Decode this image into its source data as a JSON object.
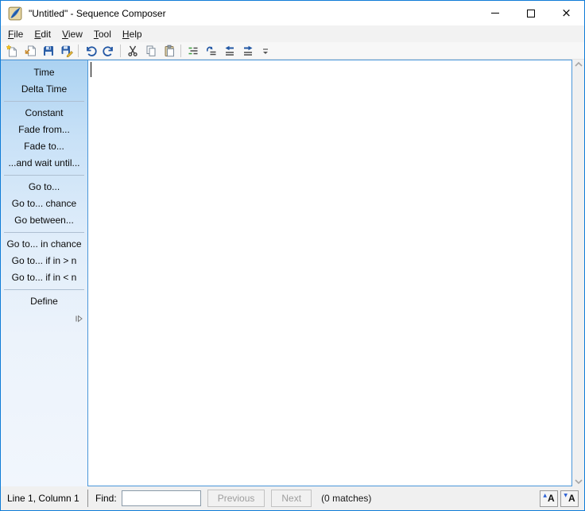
{
  "window": {
    "title": "\"Untitled\" - Sequence Composer"
  },
  "menu": {
    "items": [
      {
        "key": "F",
        "rest": "ile"
      },
      {
        "key": "E",
        "rest": "dit"
      },
      {
        "key": "V",
        "rest": "iew"
      },
      {
        "key": "T",
        "rest": "ool"
      },
      {
        "key": "H",
        "rest": "elp"
      }
    ]
  },
  "toolbar": {
    "buttons": [
      "new",
      "open",
      "save",
      "save-as",
      "undo",
      "redo",
      "cut",
      "copy",
      "paste",
      "format-document",
      "smart-indent",
      "shift-left",
      "shift-right"
    ]
  },
  "sidebar": {
    "groups": [
      {
        "items": [
          "Time",
          "Delta Time"
        ]
      },
      {
        "items": [
          "Constant",
          "Fade from...",
          "Fade to...",
          "...and wait until..."
        ]
      },
      {
        "items": [
          "Go to...",
          "Go to... chance",
          "Go between..."
        ]
      },
      {
        "items": [
          "Go to... in chance",
          "Go to... if in > n",
          "Go to... if in < n"
        ]
      },
      {
        "items": [
          "Define"
        ]
      }
    ]
  },
  "editor": {
    "content": ""
  },
  "statusbar": {
    "position": "Line 1, Column 1",
    "find_label": "Find:",
    "find_value": "",
    "previous_label": "Previous",
    "next_label": "Next",
    "matches": "(0 matches)",
    "zoom_in_label": "A",
    "zoom_out_label": "A"
  },
  "icons": {
    "close": "×",
    "zoom_in_triangle": "▲",
    "zoom_out_triangle": "▼"
  },
  "colors": {
    "accent_border": "#0f7cd7",
    "editor_border": "#4a96d9",
    "sidebar_top": "#abd2f1",
    "sidebar_bottom": "#f1f6fd",
    "statusbar_bg": "#f0f0f0"
  }
}
